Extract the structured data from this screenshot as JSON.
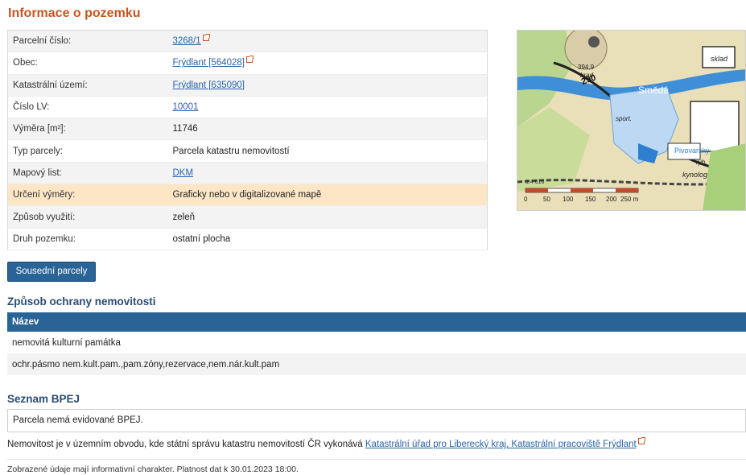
{
  "page_title": "Informace o pozemku",
  "info_rows": [
    {
      "label": "Parcelní číslo:",
      "value": "3268/1",
      "link": true,
      "ext": true
    },
    {
      "label": "Obec:",
      "value": "Frýdlant [564028]",
      "link": true,
      "ext": true
    },
    {
      "label": "Katastrální území:",
      "value": "Frýdlant [635090]",
      "link": true,
      "ext": false
    },
    {
      "label": "Číslo LV:",
      "value": "10001",
      "link": true,
      "ext": false
    },
    {
      "label": "Výměra [m²]:",
      "value": "11746",
      "link": false,
      "ext": false
    },
    {
      "label": "Typ parcely:",
      "value": "Parcela katastru nemovitostí",
      "link": false,
      "ext": false
    },
    {
      "label": "Mapový list:",
      "value": "DKM",
      "link": true,
      "ext": false
    },
    {
      "label": "Určení výměry:",
      "value": "Graficky nebo v digitalizované mapě",
      "link": false,
      "ext": false,
      "highlight": true
    },
    {
      "label": "Způsob využití:",
      "value": "zeleň",
      "link": false,
      "ext": false
    },
    {
      "label": "Druh pozemku:",
      "value": "ostatní plocha",
      "link": false,
      "ext": false
    }
  ],
  "neighbors_button": "Sousední parcely",
  "protection": {
    "heading": "Způsob ochrany nemovitosti",
    "column_header": "Název",
    "rows": [
      "nemovitá kulturní památka",
      "ochr.pásmo nem.kult.pam.,pam.zóny,rezervace,nem.nár.kult.pam"
    ]
  },
  "bpej": {
    "heading": "Seznam BPEJ",
    "text": "Parcela nemá evidované BPEJ."
  },
  "notice": {
    "text": "Nemovitost je v územním obvodu, kde státní správu katastru nemovitostí ČR vykonává ",
    "link": "Katastrální úřad pro Liberecký kraj, Katastrální pracoviště Frýdlant"
  },
  "footer": "Zobrazené údaje mají informativní charakter. Platnost dat k 30.01.2023 18:00.",
  "map": {
    "labels": {
      "hill": "394,9",
      "hrad": "hrad",
      "sklad": "sklad",
      "road_number": "290",
      "river": "Smědá",
      "sport": "sport.",
      "brewery": "Pivovarský",
      "rybn": "ryb.",
      "kynolog": "kynolog",
      "scale_ratio": "1:4 610",
      "scale_ticks": [
        "0",
        "50",
        "100",
        "150",
        "200",
        "250 m"
      ]
    }
  }
}
